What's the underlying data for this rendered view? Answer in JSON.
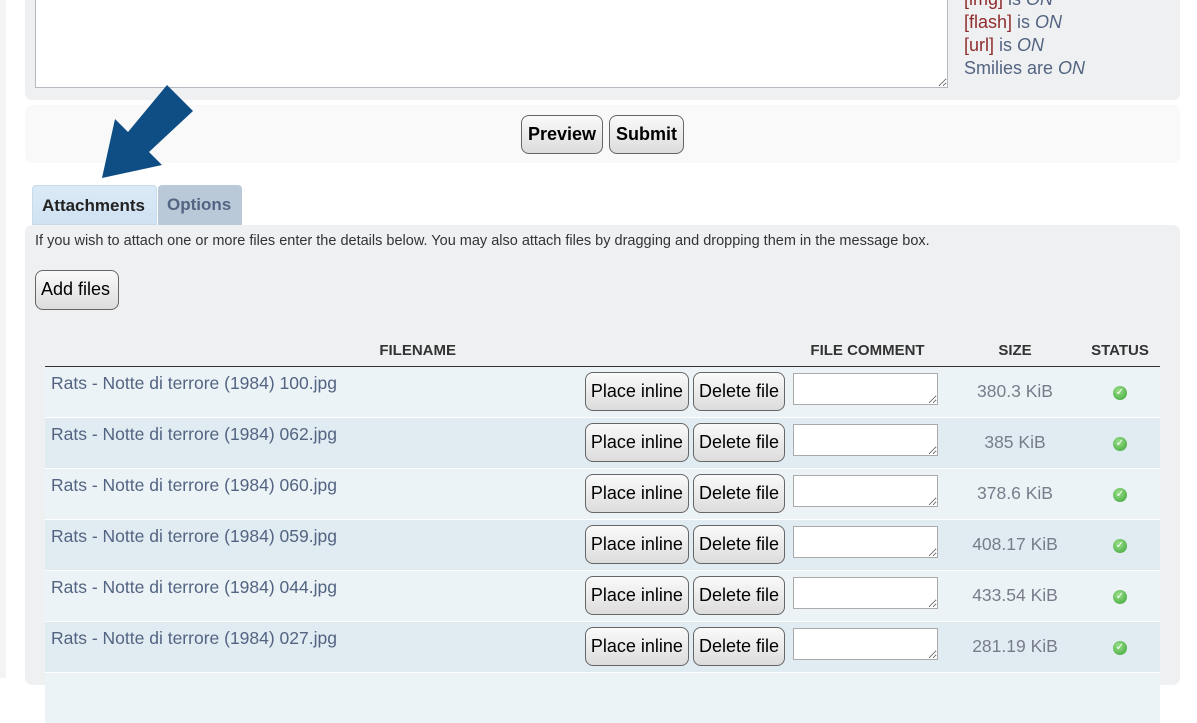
{
  "bbcode_status": [
    {
      "tag": "[img]",
      "text": " is ",
      "state": "ON"
    },
    {
      "tag": "[flash]",
      "text": " is ",
      "state": "ON"
    },
    {
      "tag": "[url]",
      "text": " is ",
      "state": "ON"
    },
    {
      "tag": "",
      "text": "Smilies are ",
      "state": "ON"
    }
  ],
  "buttons": {
    "preview": "Preview",
    "submit": "Submit",
    "add_files": "Add files"
  },
  "tabs": [
    {
      "label": "Attachments",
      "active": true
    },
    {
      "label": "Options",
      "active": false
    }
  ],
  "attach_info": "If you wish to attach one or more files enter the details below. You may also attach files by dragging and dropping them in the message box.",
  "table": {
    "headers": {
      "filename": "FILENAME",
      "comment": "FILE COMMENT",
      "size": "SIZE",
      "status": "STATUS"
    },
    "place_inline": "Place inline",
    "delete_file": "Delete file",
    "rows": [
      {
        "filename": "Rats - Notte di terrore (1984) 100.jpg",
        "size": "380.3 KiB",
        "status": "ok"
      },
      {
        "filename": "Rats - Notte di terrore (1984) 062.jpg",
        "size": "385 KiB",
        "status": "ok"
      },
      {
        "filename": "Rats - Notte di terrore (1984) 060.jpg",
        "size": "378.6 KiB",
        "status": "ok"
      },
      {
        "filename": "Rats - Notte di terrore (1984) 059.jpg",
        "size": "408.17 KiB",
        "status": "ok"
      },
      {
        "filename": "Rats - Notte di terrore (1984) 044.jpg",
        "size": "433.54 KiB",
        "status": "ok"
      },
      {
        "filename": "Rats - Notte di terrore (1984) 027.jpg",
        "size": "281.19 KiB",
        "status": "ok"
      }
    ]
  },
  "colors": {
    "arrow": "#0f4d85",
    "link": "#536482",
    "bbcode": "#8f2d2d"
  }
}
